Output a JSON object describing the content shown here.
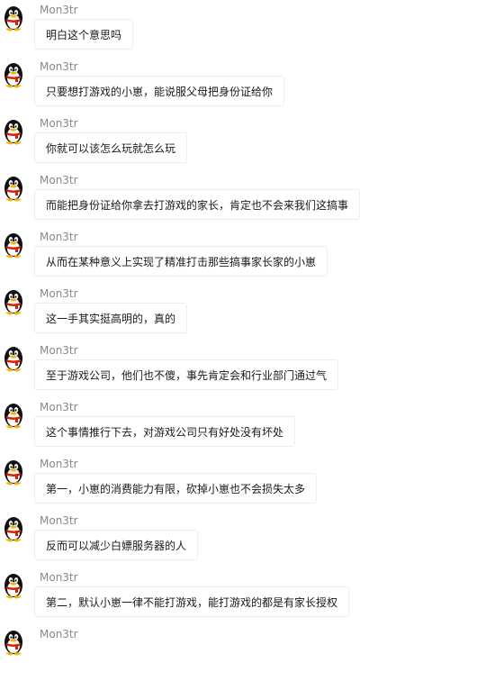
{
  "sender_name": "Mon3tr",
  "messages": [
    {
      "sender": "Mon3tr",
      "text": "明白这个意思吗"
    },
    {
      "sender": "Mon3tr",
      "text": "只要想打游戏的小崽，能说服父母把身份证给你"
    },
    {
      "sender": "Mon3tr",
      "text": "你就可以该怎么玩就怎么玩"
    },
    {
      "sender": "Mon3tr",
      "text": "而能把身份证给你拿去打游戏的家长，肯定也不会来我们这搞事"
    },
    {
      "sender": "Mon3tr",
      "text": "从而在某种意义上实现了精准打击那些搞事家长家的小崽"
    },
    {
      "sender": "Mon3tr",
      "text": "这一手其实挺高明的，真的"
    },
    {
      "sender": "Mon3tr",
      "text": "至于游戏公司，他们也不傻，事先肯定会和行业部门通过气"
    },
    {
      "sender": "Mon3tr",
      "text": "这个事情推行下去，对游戏公司只有好处没有坏处"
    },
    {
      "sender": "Mon3tr",
      "text": "第一，小崽的消费能力有限，砍掉小崽也不会损失太多"
    },
    {
      "sender": "Mon3tr",
      "text": "反而可以减少白嫖服务器的人"
    },
    {
      "sender": "Mon3tr",
      "text": "第二，默认小崽一律不能打游戏，能打游戏的都是有家长授权"
    },
    {
      "sender": "Mon3tr",
      "text": ""
    }
  ],
  "avatar_icon": "qq-penguin-icon",
  "colors": {
    "sender_text": "#888888",
    "bubble_bg": "#ffffff",
    "bubble_border": "#eeeeee",
    "message_text": "#1a1a1a",
    "penguin_body": "#111111",
    "penguin_belly": "#ffffff",
    "penguin_beak": "#f5b400",
    "penguin_scarf": "#d81e06"
  }
}
